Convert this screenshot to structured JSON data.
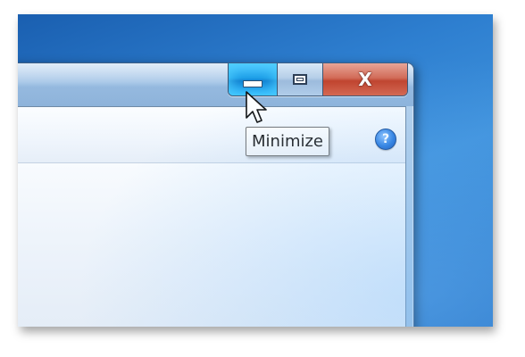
{
  "window": {
    "caption_buttons": [
      {
        "name": "minimize",
        "icon": "minimize-icon",
        "state": "hover"
      },
      {
        "name": "maximize",
        "icon": "maximize-icon",
        "state": "normal"
      },
      {
        "name": "close",
        "icon": "close-icon",
        "state": "normal"
      }
    ],
    "close_glyph": "X",
    "help_glyph": "?"
  },
  "tooltip": {
    "text": "Minimize"
  },
  "colors": {
    "desktop_blue": "#2e7fd0",
    "minimize_hover": "#1e9fe8",
    "close_red": "#c2412a",
    "help_blue": "#2f7fe0"
  },
  "cursor": {
    "icon": "arrow-pointer-icon"
  }
}
